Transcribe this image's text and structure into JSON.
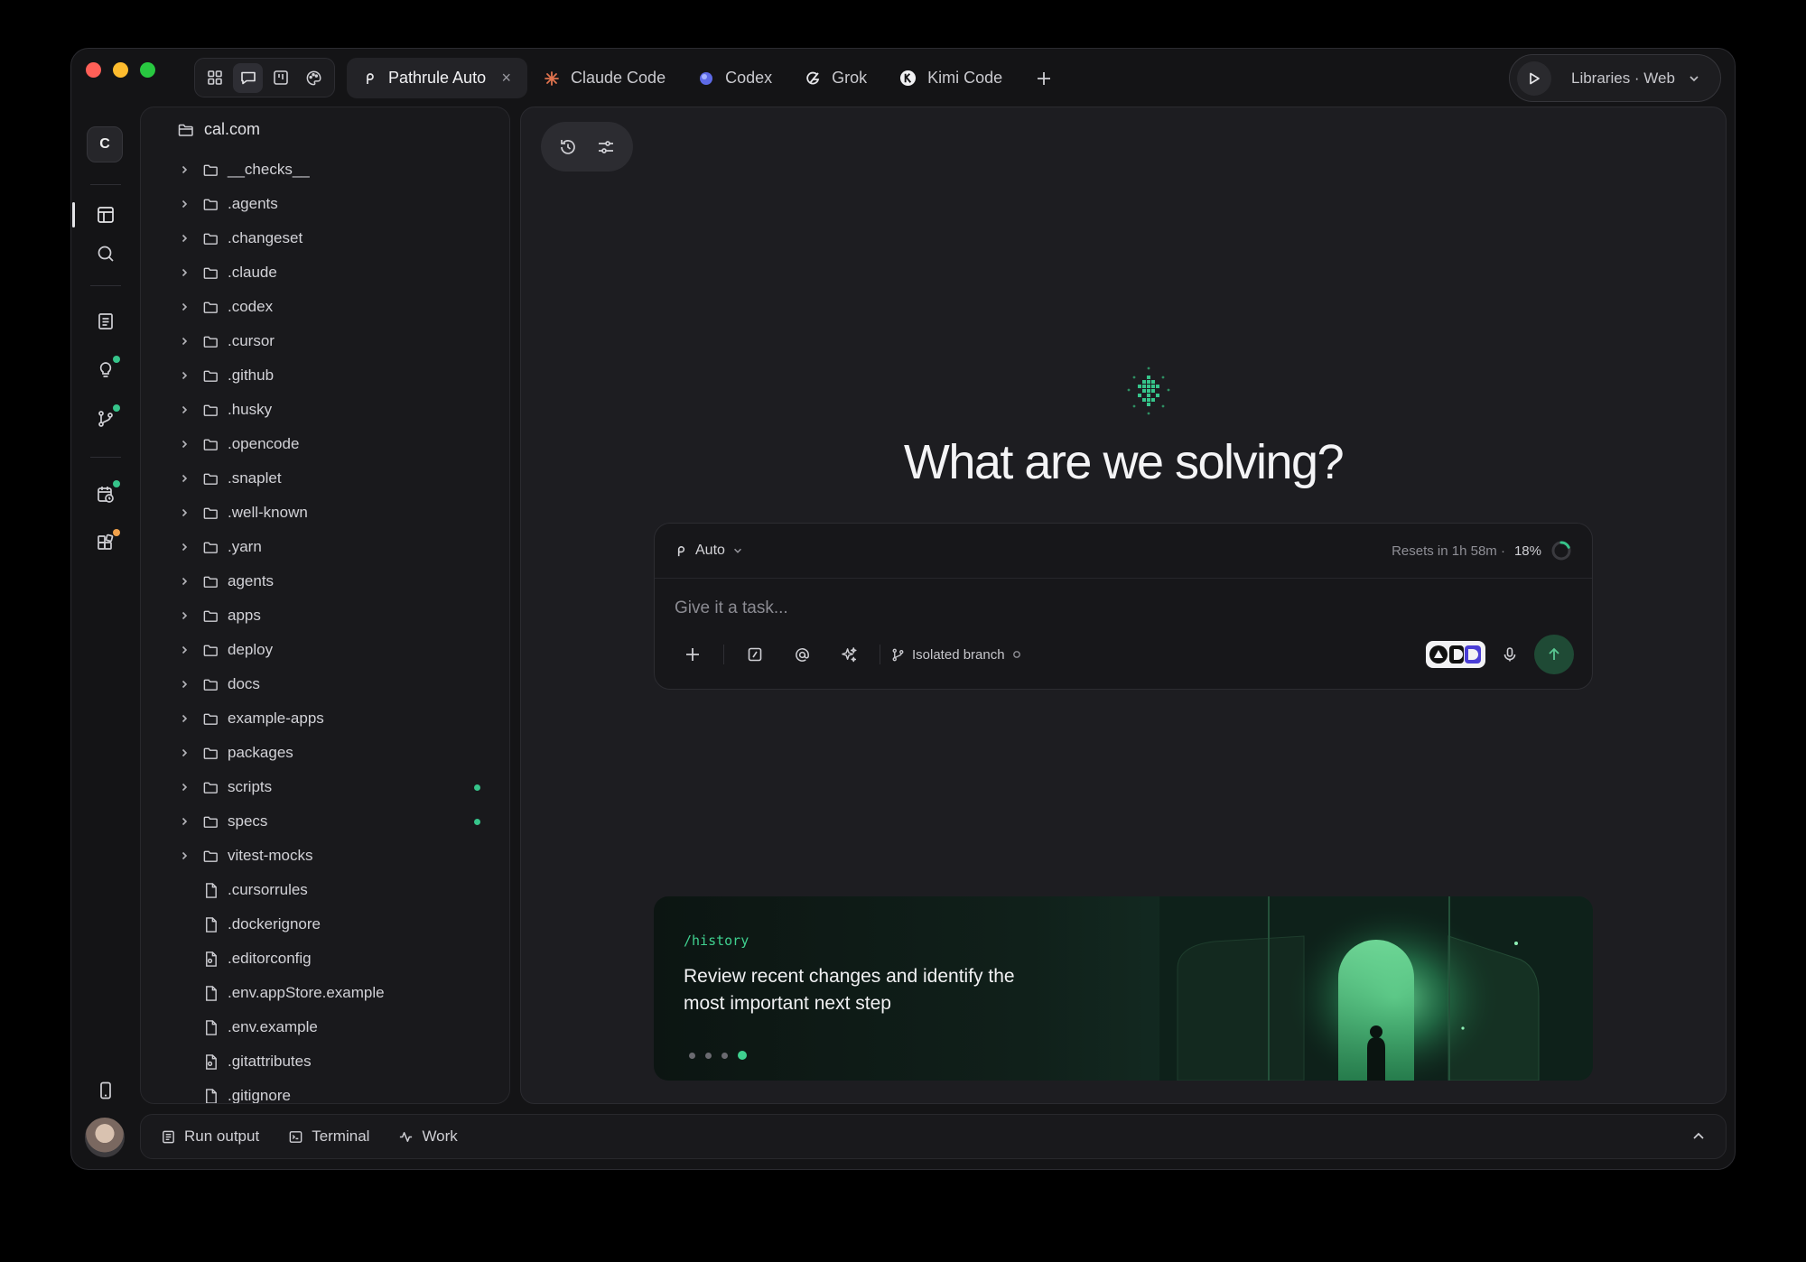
{
  "window": {
    "tabs": [
      {
        "label": "Pathrule Auto",
        "icon": "pathrule-icon",
        "active": true
      },
      {
        "label": "Claude Code",
        "icon": "claude-icon",
        "color": "#e0734e"
      },
      {
        "label": "Codex",
        "icon": "codex-icon",
        "color": "#6f7df0"
      },
      {
        "label": "Grok",
        "icon": "grok-icon"
      },
      {
        "label": "Kimi Code",
        "icon": "kimi-icon"
      }
    ],
    "tab_close": "×",
    "run": {
      "label": "Libraries · Web"
    }
  },
  "rail": {
    "workspace_initial": "C"
  },
  "tree": {
    "root": "cal.com",
    "items": [
      {
        "name": "__checks__",
        "type": "folder"
      },
      {
        "name": ".agents",
        "type": "folder"
      },
      {
        "name": ".changeset",
        "type": "folder"
      },
      {
        "name": ".claude",
        "type": "folder"
      },
      {
        "name": ".codex",
        "type": "folder"
      },
      {
        "name": ".cursor",
        "type": "folder"
      },
      {
        "name": ".github",
        "type": "folder"
      },
      {
        "name": ".husky",
        "type": "folder"
      },
      {
        "name": ".opencode",
        "type": "folder"
      },
      {
        "name": ".snaplet",
        "type": "folder"
      },
      {
        "name": ".well-known",
        "type": "folder"
      },
      {
        "name": ".yarn",
        "type": "folder"
      },
      {
        "name": "agents",
        "type": "folder"
      },
      {
        "name": "apps",
        "type": "folder"
      },
      {
        "name": "deploy",
        "type": "folder"
      },
      {
        "name": "docs",
        "type": "folder"
      },
      {
        "name": "example-apps",
        "type": "folder"
      },
      {
        "name": "packages",
        "type": "folder"
      },
      {
        "name": "scripts",
        "type": "folder",
        "modified": true
      },
      {
        "name": "specs",
        "type": "folder",
        "modified": true
      },
      {
        "name": "vitest-mocks",
        "type": "folder"
      },
      {
        "name": ".cursorrules",
        "type": "file"
      },
      {
        "name": ".dockerignore",
        "type": "file"
      },
      {
        "name": ".editorconfig",
        "type": "config"
      },
      {
        "name": ".env.appStore.example",
        "type": "file"
      },
      {
        "name": ".env.example",
        "type": "file"
      },
      {
        "name": ".gitattributes",
        "type": "config"
      },
      {
        "name": ".gitignore",
        "type": "file"
      }
    ]
  },
  "main": {
    "headline": "What are we solving?",
    "composer": {
      "model": "Auto",
      "resets": "Resets in 1h 58m ·",
      "usage_pct": "18%",
      "usage_fraction": 0.18,
      "placeholder": "Give it a task...",
      "branch_label": "Isolated branch"
    },
    "promo": {
      "command": "/history",
      "message": "Review recent changes and identify the most important next step",
      "slides": 4,
      "active_slide": 4
    }
  },
  "bottombar": {
    "items": [
      {
        "label": "Run output",
        "icon": "run-output-icon"
      },
      {
        "label": "Terminal",
        "icon": "terminal-icon"
      },
      {
        "label": "Work",
        "icon": "activity-icon"
      }
    ]
  },
  "colors": {
    "accent": "#36c48a",
    "background": "#141416",
    "panel": "#1d1d21"
  }
}
